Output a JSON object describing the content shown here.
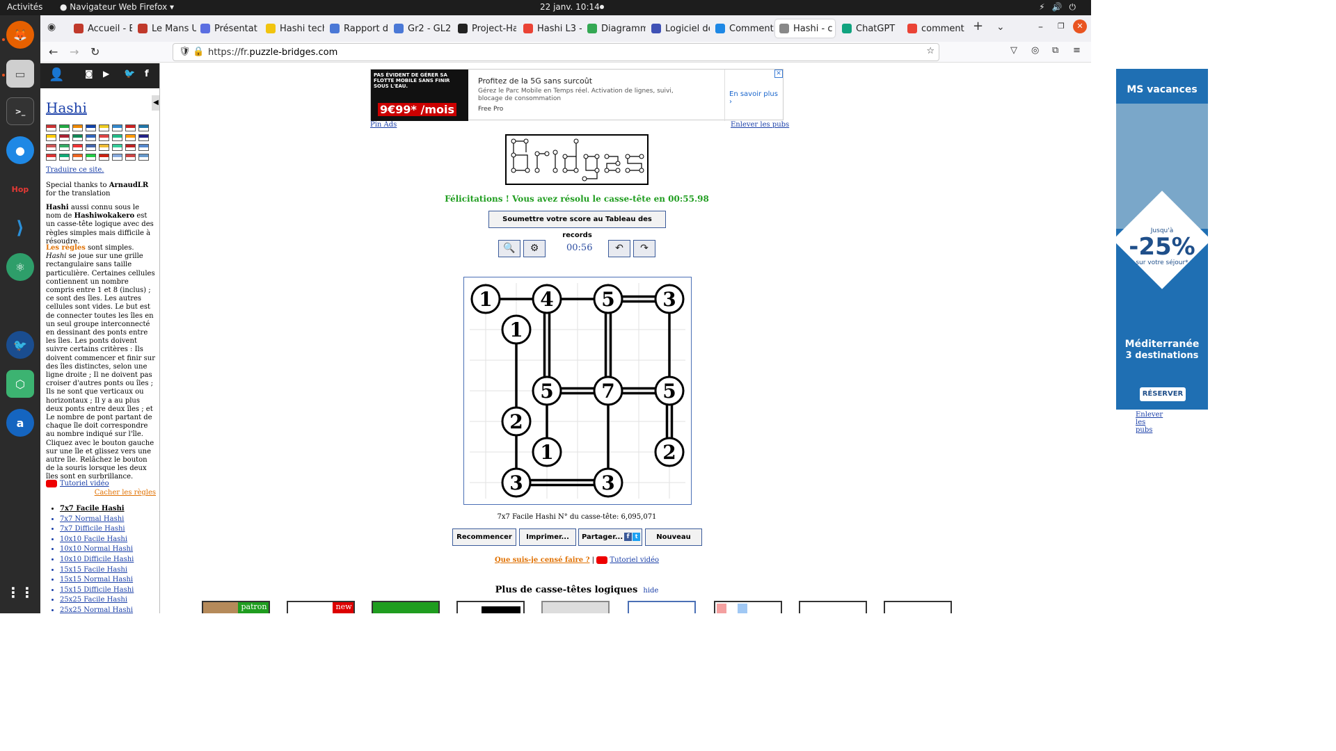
{
  "system": {
    "activities": "Activités",
    "app_name": "Navigateur Web Firefox",
    "clock": "22 janv.  10:14"
  },
  "tabs": [
    {
      "label": "Accueil - E",
      "color": "#c0392b"
    },
    {
      "label": "Le Mans U",
      "color": "#c0392b"
    },
    {
      "label": "Présentat",
      "color": "#5b6ee1"
    },
    {
      "label": "Hashi tech",
      "color": "#f1c40f"
    },
    {
      "label": "Rapport d",
      "color": "#4a78d6"
    },
    {
      "label": "Gr2 - GL2",
      "color": "#4a78d6"
    },
    {
      "label": "Project-Ha",
      "color": "#222222"
    },
    {
      "label": "Hashi L3 -",
      "color": "#ea4335"
    },
    {
      "label": "Diagramm",
      "color": "#34a853"
    },
    {
      "label": "Logiciel de",
      "color": "#3f51b5"
    },
    {
      "label": "Comment",
      "color": "#1e88e5"
    },
    {
      "label": "Hashi - c",
      "color": "#888888"
    },
    {
      "label": "ChatGPT",
      "color": "#10a37f"
    },
    {
      "label": "comment",
      "color": "#ea4335"
    }
  ],
  "url": {
    "prefix": "https://fr.",
    "domain": "puzzle-bridges.com"
  },
  "sidebar": {
    "title": "Hashi",
    "translate": "Traduire ce site.",
    "thanks_pre": "Special thanks to ",
    "thanks_name": "ArnaudLR",
    "thanks_post": " for the translation",
    "intro_b1": "Hashi",
    "intro_1": " aussi connu sous le nom de ",
    "intro_b2": "Hashiwokakero",
    "intro_2": " est un casse-tête logique avec des règles simples mais difficile à résoudre.",
    "rules_label": "Les règles",
    "rules_1": " sont simples. ",
    "rules_hashi": "Hashi",
    "rules_2": " se joue sur une grille rectangulaire sans taille particulière. Certaines cellules contiennent un nombre compris entre 1 et 8 (inclus) ; ce sont des îles. Les autres cellules sont vides. Le but est de connecter toutes les îles en un seul groupe interconnecté en dessinant des ponts entre les îles. Les ponts doivent suivre certains critères : Ils doivent commencer et finir sur des îles distinctes, selon une ligne droite ; Il ne doivent pas croiser d'autres ponts ou îles ; Ils ne sont que verticaux ou horizontaux ; Il y a au plus deux ponts entre deux îles ; et Le nombre de pont partant de chaque île doit correspondre au nombre indiqué sur l'île.",
    "rules_3": "Cliquez avec le bouton gauche sur une île et glissez vers une autre île. Relâchez le bouton de la souris lorsque les deux îles sont en surbrillance.",
    "video": "Tutoriel vidéo",
    "hide_rules": "Cacher les règles",
    "levels": [
      "7x7 Facile Hashi",
      "7x7 Normal Hashi",
      "7x7 Difficile Hashi",
      "10x10 Facile Hashi",
      "10x10 Normal Hashi",
      "10x10 Difficile Hashi",
      "15x15 Facile Hashi",
      "15x15 Normal Hashi",
      "15x15 Difficile Hashi",
      "25x25 Facile Hashi",
      "25x25 Normal Hashi"
    ]
  },
  "ad_top": {
    "img_text": "PAS ÉVIDENT DE GÉRER SA FLOTTE MOBILE SANS FINIR SOUS L'EAU.",
    "price": "9€99* /mois",
    "title": "Profitez de la 5G sans surcoût",
    "desc": "Gérez le Parc Mobile en Temps réel. Activation de lignes, suivi, blocage de consommation",
    "brand": "Free Pro",
    "cta": "En savoir plus ›",
    "pin": "Pin Ads",
    "remove": "Enlever les pubs"
  },
  "game": {
    "congrats": "Félicitations ! Vous avez résolu le casse-tête en 00:55.98",
    "submit": "Soumettre votre score au Tableau des records",
    "timer": "00:56",
    "puzzle_info": "7x7 Facile Hashi N° du casse-tête: 6,095,071",
    "buttons": {
      "restart": "Recommencer",
      "print": "Imprimer...",
      "share": "Partager...",
      "new": "Nouveau"
    },
    "help": "Que suis-je censé faire ?",
    "help_video": "Tutoriel vidéo",
    "more": "Plus de casse-têtes logiques",
    "hide": "hide",
    "thumb_labels": [
      "patron",
      "new"
    ]
  },
  "islands": [
    {
      "r": 0,
      "c": 0,
      "n": 1
    },
    {
      "r": 0,
      "c": 2,
      "n": 4
    },
    {
      "r": 0,
      "c": 4,
      "n": 5
    },
    {
      "r": 0,
      "c": 6,
      "n": 3
    },
    {
      "r": 1,
      "c": 1,
      "n": 1
    },
    {
      "r": 3,
      "c": 2,
      "n": 5
    },
    {
      "r": 3,
      "c": 4,
      "n": 7
    },
    {
      "r": 3,
      "c": 6,
      "n": 5
    },
    {
      "r": 4,
      "c": 1,
      "n": 2
    },
    {
      "r": 5,
      "c": 2,
      "n": 1
    },
    {
      "r": 5,
      "c": 6,
      "n": 2
    },
    {
      "r": 6,
      "c": 1,
      "n": 3
    },
    {
      "r": 6,
      "c": 4,
      "n": 3
    }
  ],
  "bridges": [
    {
      "a": 0,
      "b": 1,
      "count": 1
    },
    {
      "a": 1,
      "b": 2,
      "count": 1
    },
    {
      "a": 2,
      "b": 3,
      "count": 2
    },
    {
      "a": 1,
      "b": 5,
      "count": 2
    },
    {
      "a": 2,
      "b": 6,
      "count": 2
    },
    {
      "a": 3,
      "b": 7,
      "count": 1
    },
    {
      "a": 4,
      "b": 8,
      "count": 1
    },
    {
      "a": 5,
      "b": 6,
      "count": 2
    },
    {
      "a": 6,
      "b": 7,
      "count": 2
    },
    {
      "a": 5,
      "b": 9,
      "count": 1
    },
    {
      "a": 7,
      "b": 10,
      "count": 2
    },
    {
      "a": 8,
      "b": 11,
      "count": 1
    },
    {
      "a": 6,
      "b": 12,
      "count": 1
    },
    {
      "a": 11,
      "b": 12,
      "count": 2
    }
  ],
  "right_ad": {
    "brand": "MS vacances",
    "line1": "Jusqu'à",
    "discount": "-25%",
    "line2": "sur votre séjour*",
    "dest": "Méditerranée",
    "dest2": "3 destinations",
    "cta": "RÉSERVER",
    "remove": "Enlever les pubs"
  },
  "colors": {
    "accent": "#1f9d1f",
    "link": "#1a3fa8",
    "orange": "#e07000"
  }
}
